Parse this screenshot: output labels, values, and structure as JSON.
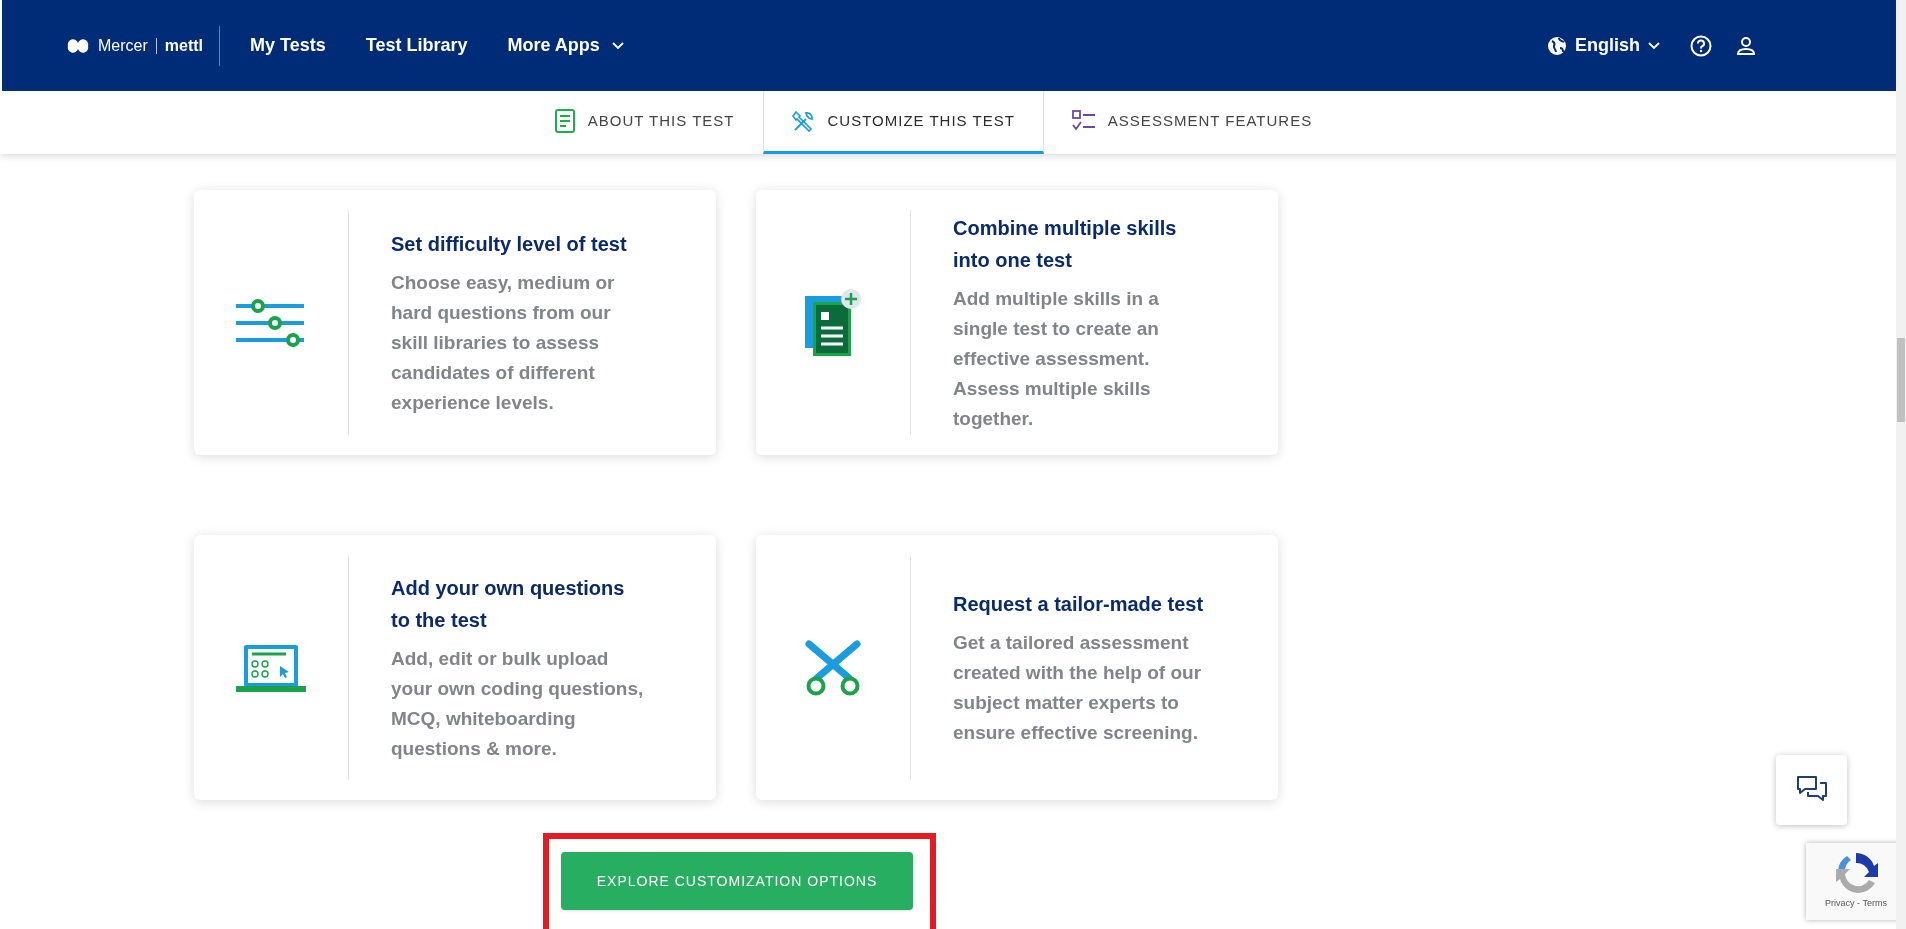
{
  "header": {
    "logo_brand": "Mercer",
    "logo_product": "mettl",
    "nav": [
      {
        "label": "My Tests",
        "dropdown": false
      },
      {
        "label": "Test Library",
        "dropdown": false
      },
      {
        "label": "More Apps",
        "dropdown": true
      }
    ],
    "language": "English"
  },
  "tabs": [
    {
      "label": "ABOUT THIS TEST",
      "kind": "document",
      "selected": false
    },
    {
      "label": "CUSTOMIZE THIS TEST",
      "kind": "tools",
      "selected": true
    },
    {
      "label": "ASSESSMENT FEATURES",
      "kind": "checklist",
      "selected": false
    }
  ],
  "cards": [
    {
      "kind": "sliders",
      "title": "Set difficulty level of test",
      "text": "Choose easy, medium or hard questions from our skill libraries to assess candidates of different experience levels."
    },
    {
      "kind": "add-document",
      "title": "Combine multiple skills into one test",
      "text": "Add multiple skills in a single test to create an effective assessment. Assess multiple skills together."
    },
    {
      "kind": "laptop",
      "title": "Add your own questions to the test",
      "text": "Add, edit or bulk upload your own coding questions, MCQ, whiteboarding questions & more."
    },
    {
      "kind": "scissors",
      "title": "Request a tailor-made test",
      "text": "Get a tailored assessment created with the help of our subject matter experts to ensure effective screening."
    }
  ],
  "cta_button": "EXPLORE CUSTOMIZATION OPTIONS",
  "recaptcha": {
    "links": "Privacy - Terms"
  }
}
